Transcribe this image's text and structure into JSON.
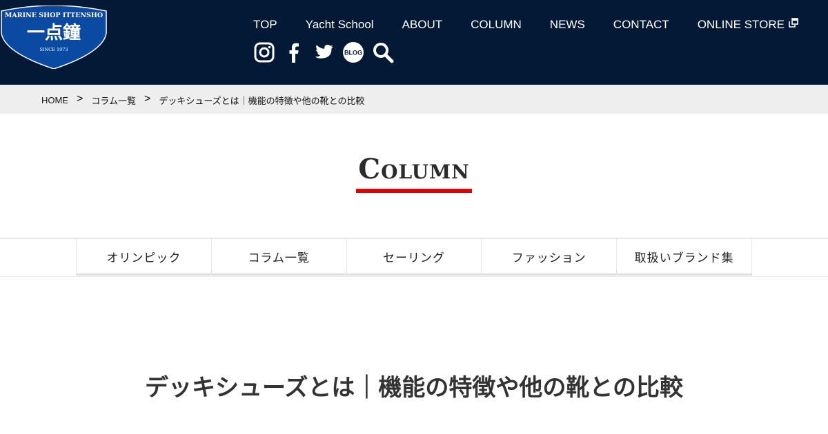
{
  "logo": {
    "top_text": "MARINE SHOP ITTENSHO",
    "main_text": "一点鐘",
    "since_text": "SINCE 1973",
    "brand_color": "#0b4aa2"
  },
  "header": {
    "background": "#031936",
    "nav": [
      {
        "label": "TOP"
      },
      {
        "label": "Yacht School"
      },
      {
        "label": "ABOUT"
      },
      {
        "label": "COLUMN"
      },
      {
        "label": "NEWS"
      },
      {
        "label": "CONTACT"
      },
      {
        "label": "ONLINE STORE",
        "icon": "external-link-icon"
      }
    ],
    "social": [
      {
        "icon": "instagram-icon"
      },
      {
        "icon": "facebook-icon"
      },
      {
        "icon": "twitter-icon"
      },
      {
        "icon": "blog-icon",
        "label": "BLOG"
      },
      {
        "icon": "search-icon"
      }
    ]
  },
  "breadcrumb": {
    "items": [
      "HOME",
      "コラム一覧",
      "デッキシューズとは｜機能の特徴や他の靴との比較"
    ],
    "separator": ">"
  },
  "section": {
    "title": "Column",
    "accent": "#e00000"
  },
  "categories": [
    {
      "label": "オリンピック"
    },
    {
      "label": "コラム一覧"
    },
    {
      "label": "セーリング"
    },
    {
      "label": "ファッション"
    },
    {
      "label": "取扱いブランド集"
    }
  ],
  "article": {
    "title": "デッキシューズとは｜機能の特徴や他の靴との比較"
  }
}
